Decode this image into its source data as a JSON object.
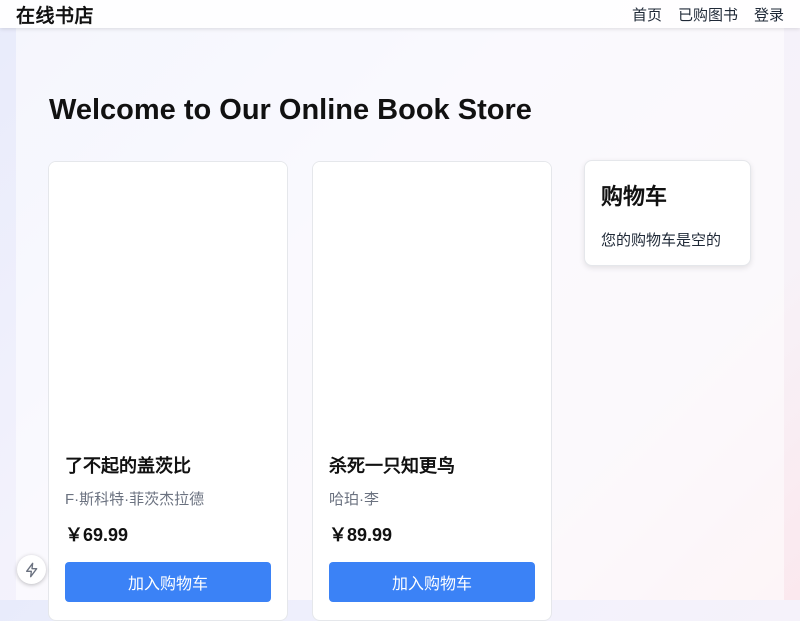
{
  "header": {
    "brand": "在线书店",
    "nav": [
      "首页",
      "已购图书",
      "登录"
    ]
  },
  "main": {
    "title": "Welcome to Our Online Book Store"
  },
  "books": [
    {
      "title": "了不起的盖茨比",
      "author": "F·斯科特·菲茨杰拉德",
      "price": "￥69.99",
      "button": "加入购物车"
    },
    {
      "title": "杀死一只知更鸟",
      "author": "哈珀·李",
      "price": "￥89.99",
      "button": "加入购物车"
    }
  ],
  "cart": {
    "title": "购物车",
    "empty_text": "您的购物车是空的"
  },
  "colors": {
    "accent": "#3b82f6"
  },
  "icons": {
    "fab": "lightning-icon"
  }
}
